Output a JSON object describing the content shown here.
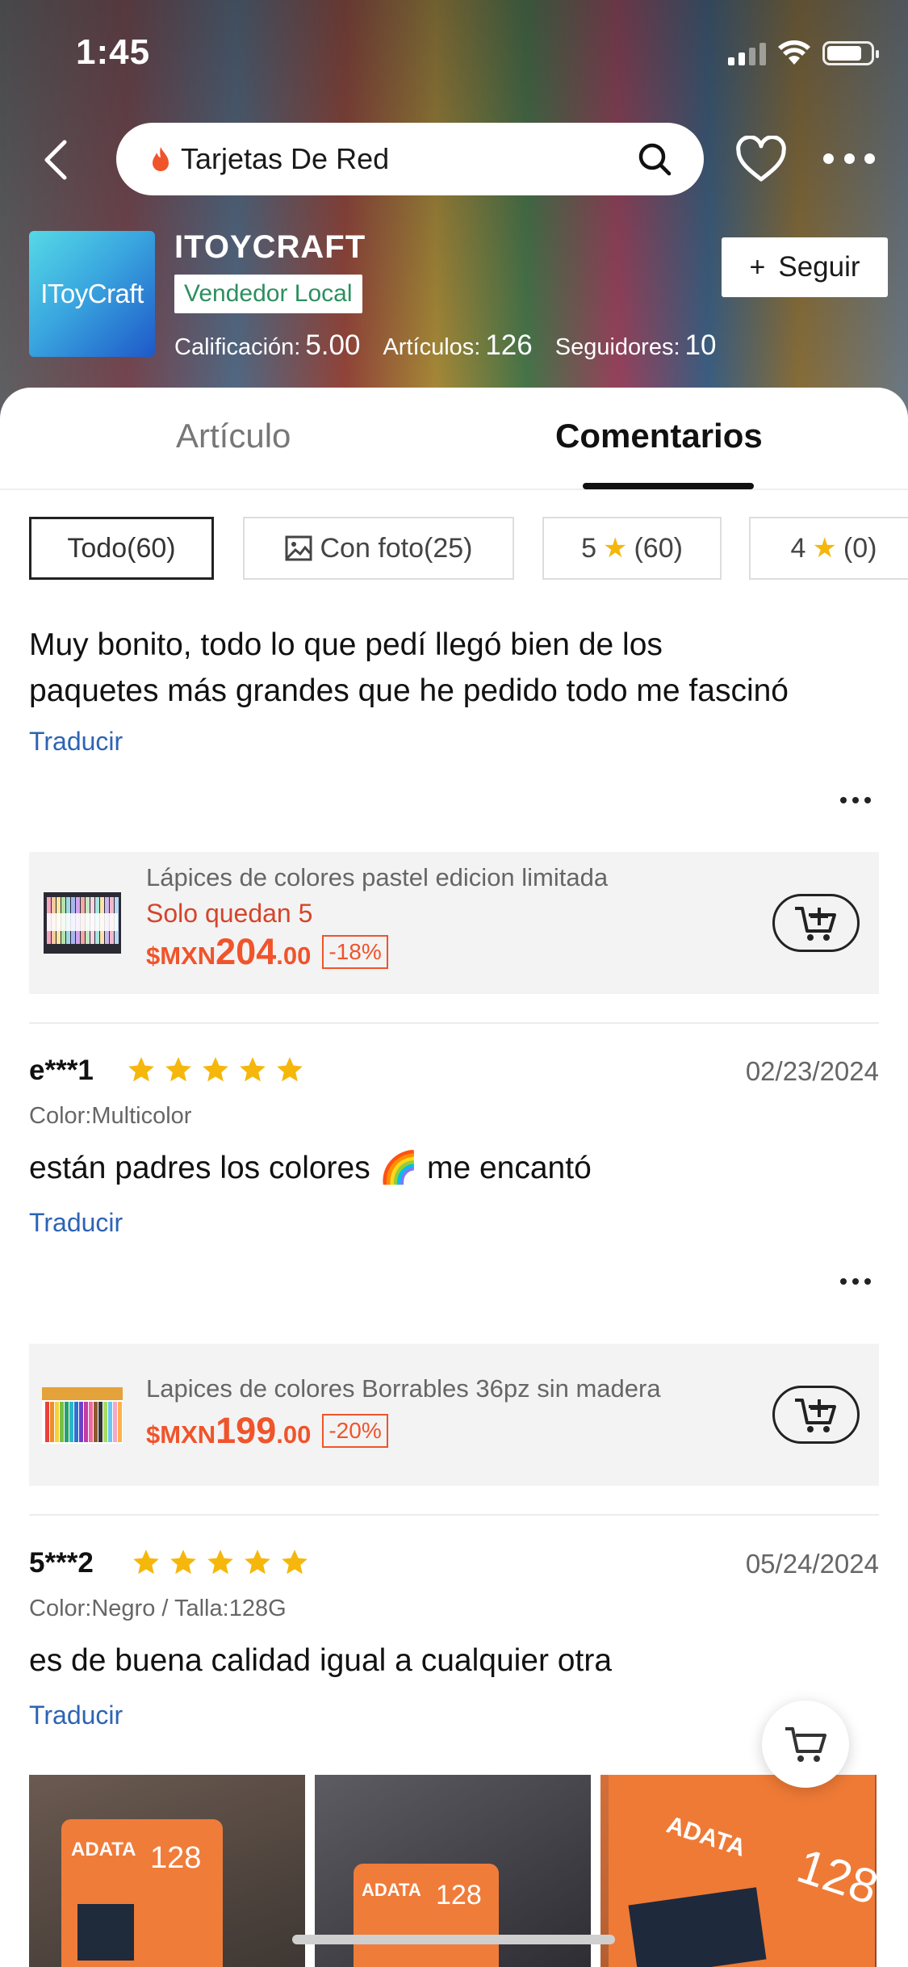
{
  "status": {
    "time": "1:45"
  },
  "search": {
    "query": "Tarjetas De Red"
  },
  "shop": {
    "logo_text": "IToyCraft",
    "name": "ITOYCRAFT",
    "badge": "Vendedor Local",
    "rating_label": "Calificación:",
    "rating_value": "5.00",
    "items_label": "Artículos:",
    "items_value": "126",
    "followers_label": "Seguidores:",
    "followers_value": "10",
    "follow_label": "Seguir"
  },
  "tabs": [
    {
      "label": "Artículo"
    },
    {
      "label": "Comentarios"
    }
  ],
  "filters": {
    "all": "Todo(60)",
    "photo": "Con foto(25)",
    "five_num": "5",
    "five_count": "(60)",
    "four_num": "4",
    "four_count": "(0)"
  },
  "reviews": [
    {
      "text_lines": [
        "Muy bonito, todo lo que pedí llegó bien de los",
        "paquetes más grandes que he pedido todo me fascinó"
      ],
      "translate": "Traducir",
      "product": {
        "name": "Lápices de colores pastel edicion limitada",
        "stock": "Solo quedan 5",
        "currency": "$MXN",
        "price_int": "204",
        "price_dec": ".00",
        "discount": "-18%"
      }
    },
    {
      "user": "e***1",
      "stars": 5,
      "date": "02/23/2024",
      "attr": "Color:Multicolor",
      "text": "están padres los colores 🌈 me encantó",
      "translate": "Traducir",
      "product": {
        "name": "Lapices de colores Borrables 36pz sin madera",
        "currency": "$MXN",
        "price_int": "199",
        "price_dec": ".00",
        "discount": "-20%"
      }
    },
    {
      "user": "5***2",
      "stars": 5,
      "date": "05/24/2024",
      "attr": "Color:Negro / Talla:128G",
      "text": "es de buena calidad  igual a cualquier otra",
      "translate": "Traducir",
      "photos": [
        {
          "brand": "ADATA",
          "capacity": "128"
        },
        {
          "brand": "ADATA",
          "capacity": "128"
        },
        {
          "brand": "ADATA",
          "capacity": "128"
        }
      ]
    }
  ],
  "colors": {
    "accent": "#f0542b",
    "link": "#2d63b5",
    "star": "#f5b70b",
    "badge": "#2c8f5e"
  }
}
